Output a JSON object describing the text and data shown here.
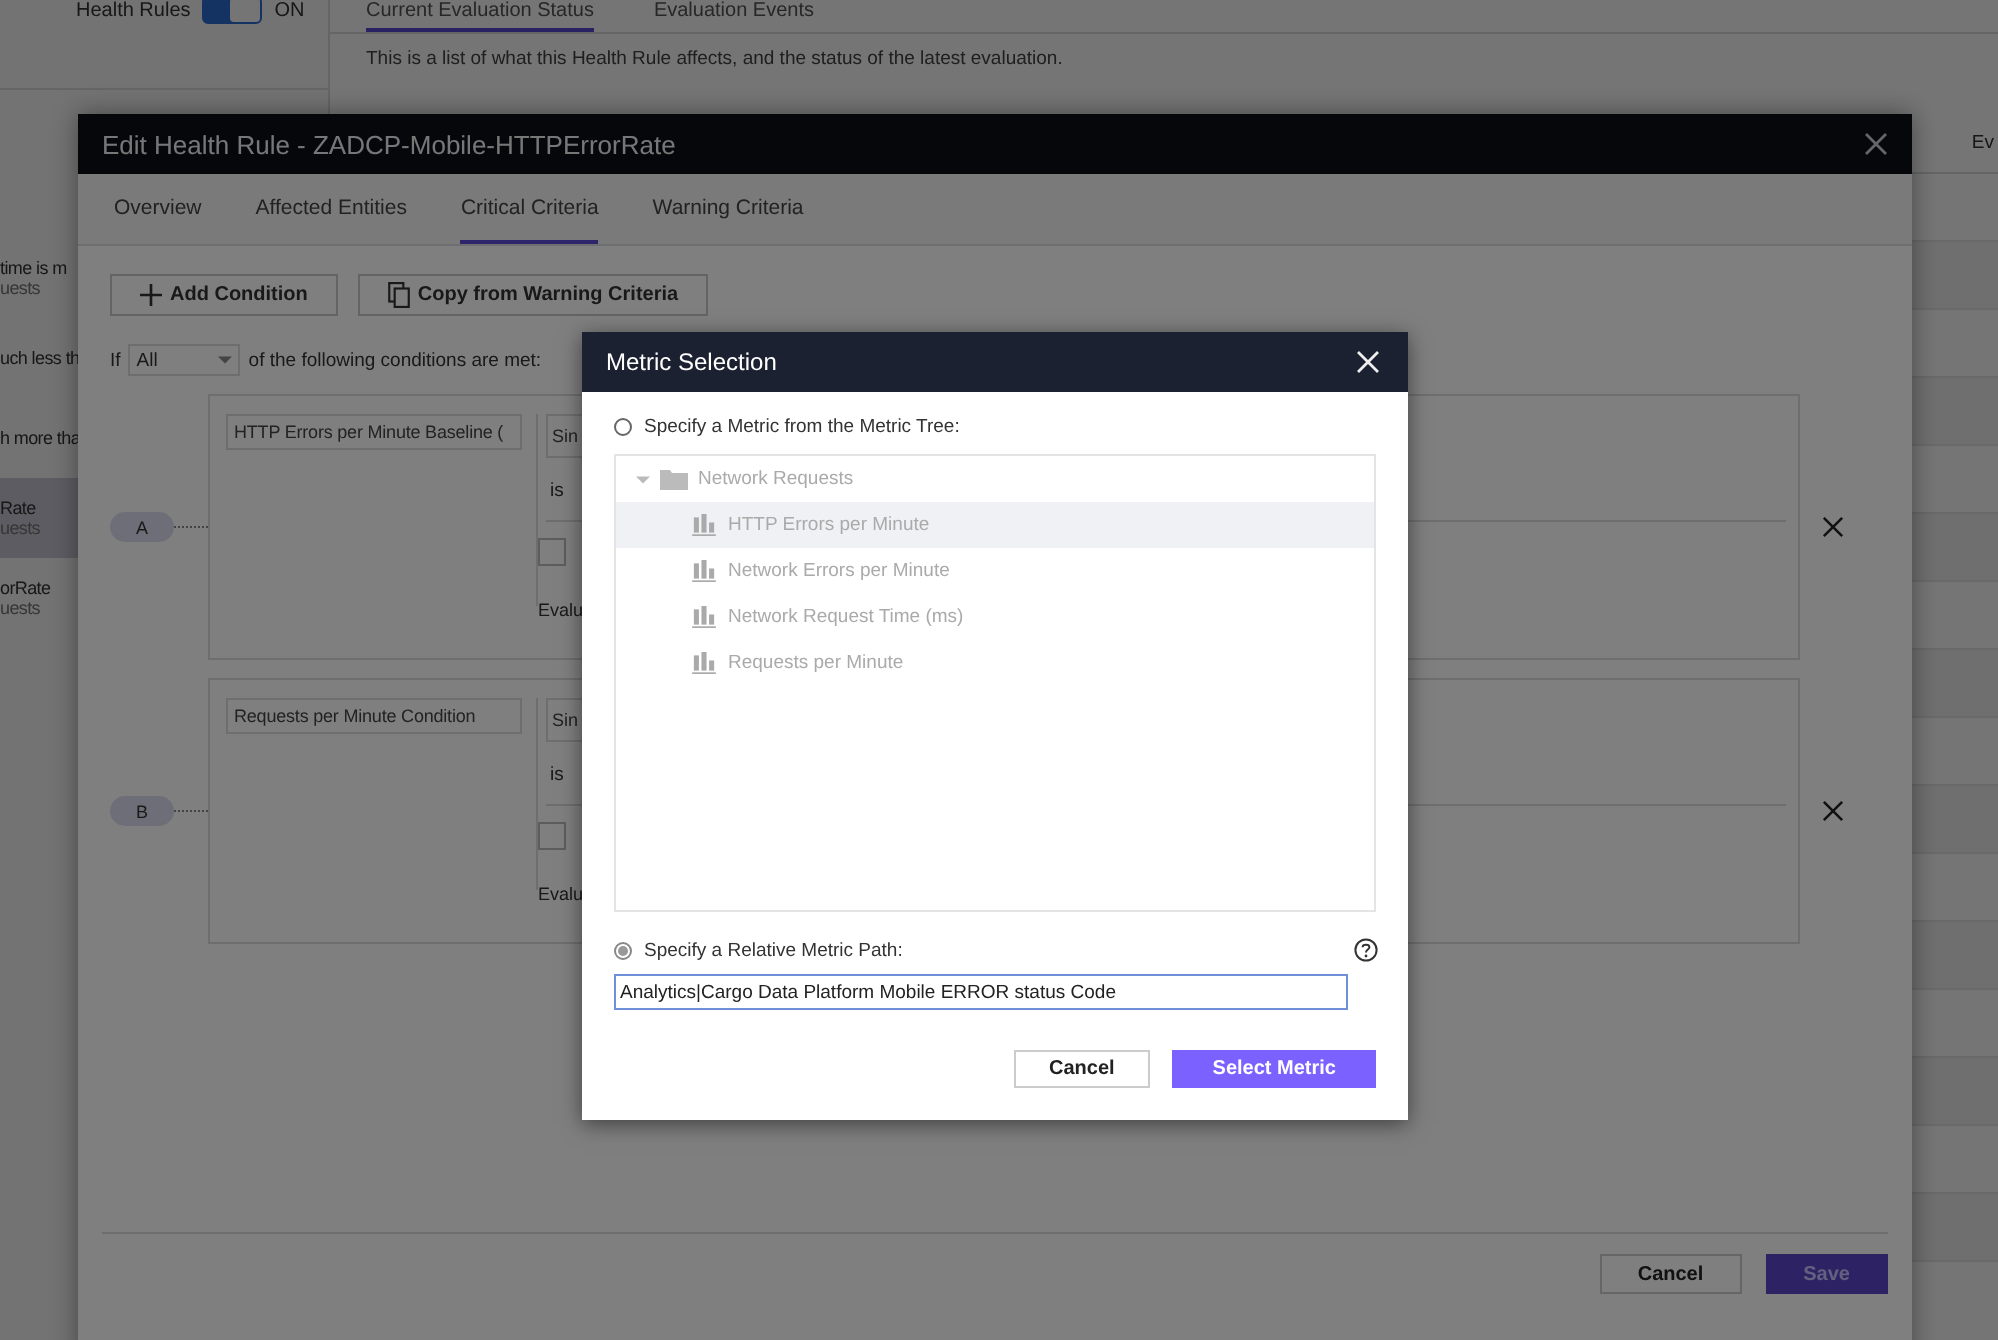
{
  "page": {
    "toggle": {
      "label": "Health Rules",
      "on": true,
      "state_text": "ON"
    },
    "sidebar_items": [
      {
        "title": "time is m",
        "subtitle": "uests",
        "selected": false
      },
      {
        "title": "uch less th",
        "selected": false
      },
      {
        "title": "h more tha",
        "selected": false
      },
      {
        "title": "Rate",
        "subtitle": "uests",
        "selected": true
      },
      {
        "title": "orRate",
        "subtitle": "uests",
        "selected": false
      }
    ],
    "tabs": [
      {
        "label": "Current Evaluation Status",
        "selected": true
      },
      {
        "label": "Evaluation Events",
        "selected": false
      }
    ],
    "description": "This is a list of what this Health Rule affects, and the status of the latest evaluation.",
    "column_header": "Ev"
  },
  "dialog": {
    "title": "Edit Health Rule - ZADCP-Mobile-HTTPErrorRate",
    "tabs": [
      {
        "label": "Overview",
        "selected": false
      },
      {
        "label": "Affected Entities",
        "selected": false
      },
      {
        "label": "Critical Criteria",
        "selected": true
      },
      {
        "label": "Warning Criteria",
        "selected": false
      }
    ],
    "actions": [
      {
        "label": "Add Condition",
        "kind": "add"
      },
      {
        "label": "Copy from Warning Criteria",
        "kind": "copy"
      }
    ],
    "condition_prefix": "If",
    "match": "All",
    "condition_suffix": "of the following conditions are met:",
    "conditions": [
      {
        "letter": "A",
        "name": "HTTP Errors per Minute Baseline (",
        "type_field": "Sin",
        "operator": "is",
        "checked": false,
        "evaluate_label": "Evalu"
      },
      {
        "letter": "B",
        "name": "Requests per Minute Condition",
        "type_field": "Sin",
        "operator": "is",
        "checked": false,
        "evaluate_label": "Evalu"
      }
    ],
    "footer_buttons": [
      {
        "label": "Cancel",
        "kind": "secondary"
      },
      {
        "label": "Save",
        "kind": "primary"
      }
    ]
  },
  "metric_modal": {
    "title": "Metric Selection",
    "options": [
      {
        "label": "Specify a Metric from the Metric Tree:",
        "selected": false,
        "kind": "tree"
      },
      {
        "label": "Specify a Relative Metric Path:",
        "selected": true,
        "kind": "path"
      }
    ],
    "tree": [
      {
        "label": "Network Requests",
        "expanded": true,
        "children": [
          {
            "label": "HTTP Errors per Minute",
            "selected": true
          },
          {
            "label": "Network Errors per Minute",
            "selected": false
          },
          {
            "label": "Network Request Time (ms)",
            "selected": false
          },
          {
            "label": "Requests per Minute",
            "selected": false
          }
        ]
      }
    ],
    "path_value": "Analytics|Cargo Data Platform Mobile ERROR status Code",
    "buttons": [
      {
        "label": "Cancel",
        "kind": "secondary"
      },
      {
        "label": "Select Metric",
        "kind": "primary"
      }
    ]
  }
}
